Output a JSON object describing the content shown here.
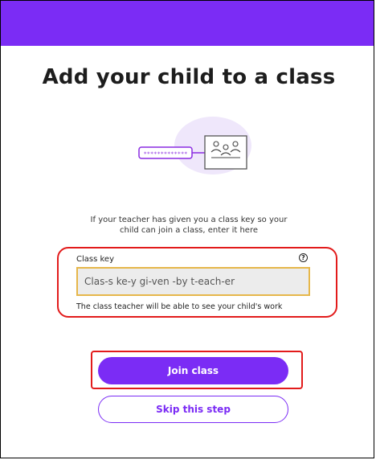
{
  "page": {
    "title": "Add your child to a class",
    "description": "If your teacher has given you a class key so your child can join a class, enter it here"
  },
  "illustration": {
    "key_text": "*************",
    "icon": "classroom-board-icon"
  },
  "form": {
    "label": "Class key",
    "help_icon": "?",
    "value": "Clas-s ke-y gi-ven -by t-each-er",
    "helper_text": "The class teacher will be able to see your child's work"
  },
  "buttons": {
    "join": "Join class",
    "skip": "Skip this step"
  },
  "colors": {
    "brand": "#7b2cf5",
    "highlight": "#e21b1b",
    "input_border": "#e6b74a"
  }
}
